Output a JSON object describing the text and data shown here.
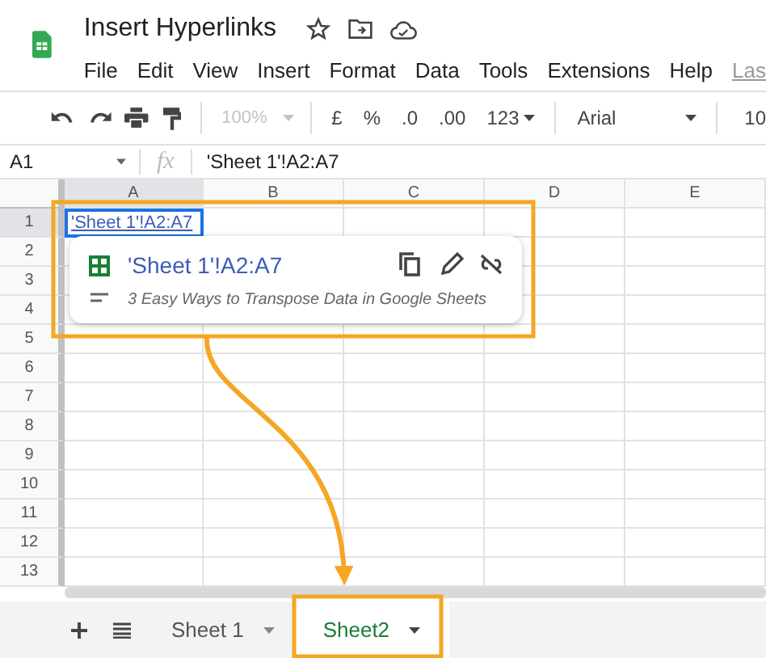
{
  "app": {
    "title": "Insert Hyperlinks"
  },
  "menu": [
    "File",
    "Edit",
    "View",
    "Insert",
    "Format",
    "Data",
    "Tools",
    "Extensions",
    "Help",
    "Las"
  ],
  "toolbar": {
    "zoom": {
      "value": "100%",
      "disabled": true
    },
    "formats": [
      "£",
      "%",
      ".0",
      ".00",
      "123"
    ],
    "font": "Arial",
    "font_size": "10"
  },
  "formula_bar": {
    "cell_ref": "A1",
    "fx": "fx",
    "value": "'Sheet 1'!A2:A7"
  },
  "grid": {
    "columns": [
      {
        "label": "A",
        "selected": true
      },
      {
        "label": "B",
        "selected": false
      },
      {
        "label": "C",
        "selected": false
      },
      {
        "label": "D",
        "selected": false
      },
      {
        "label": "E",
        "selected": false
      }
    ],
    "rows": [
      {
        "label": "1",
        "selected": true
      },
      {
        "label": "2",
        "selected": false
      },
      {
        "label": "3",
        "selected": false
      },
      {
        "label": "4",
        "selected": false
      },
      {
        "label": "5",
        "selected": false
      },
      {
        "label": "6",
        "selected": false
      },
      {
        "label": "7",
        "selected": false
      },
      {
        "label": "8",
        "selected": false
      },
      {
        "label": "9",
        "selected": false
      },
      {
        "label": "10",
        "selected": false
      },
      {
        "label": "11",
        "selected": false
      },
      {
        "label": "12",
        "selected": false
      },
      {
        "label": "13",
        "selected": false
      }
    ],
    "active_cell": {
      "text": "'Sheet 1'!A2:A7"
    }
  },
  "link_popup": {
    "title": "'Sheet 1'!A2:A7",
    "description": "3 Easy Ways to Transpose Data in Google Sheets"
  },
  "sheet_tabs": [
    {
      "label": "Sheet 1",
      "selected": false
    },
    {
      "label": "Sheet2",
      "selected": true
    }
  ]
}
